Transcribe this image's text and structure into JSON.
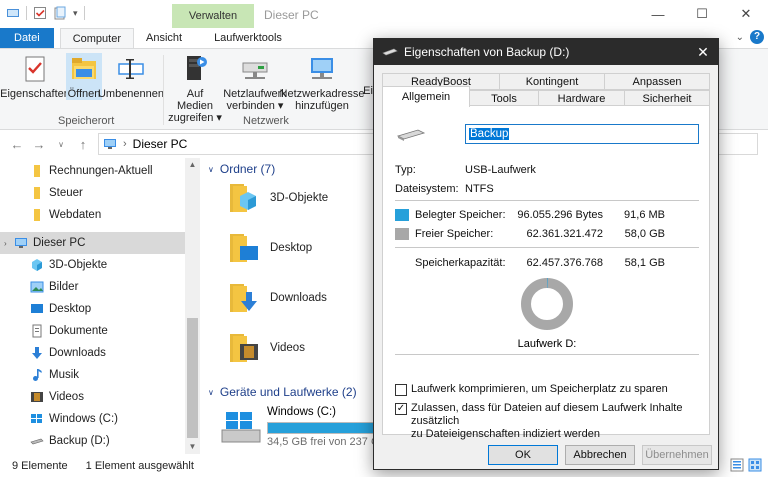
{
  "titlebar": {
    "context_tab": "Verwalten",
    "title": "Dieser PC",
    "minimize": "—",
    "maximize": "☐",
    "close": "✕"
  },
  "ribbon_tabs": {
    "file": "Datei",
    "computer": "Computer",
    "view": "Ansicht",
    "drive_tools": "Laufwerktools"
  },
  "ribbon": {
    "properties": "Eigenschaften",
    "open": "Öffnen",
    "rename": "Umbenennen",
    "access_media_1": "Auf Medien",
    "access_media_2": "zugreifen ▾",
    "map_drive_1": "Netzlaufwerk",
    "map_drive_2": "verbinden ▾",
    "add_network_1": "Netzwerkadresse",
    "add_network_2": "hinzufügen",
    "truncated": "Ei",
    "group_location": "Speicherort",
    "group_network": "Netzwerk"
  },
  "address": {
    "path": "Dieser PC",
    "sep": "›"
  },
  "sidebar": {
    "items": [
      {
        "label": "Rechnungen-Aktuell"
      },
      {
        "label": "Steuer"
      },
      {
        "label": "Webdaten"
      },
      {
        "label": "Dieser PC"
      },
      {
        "label": "3D-Objekte"
      },
      {
        "label": "Bilder"
      },
      {
        "label": "Desktop"
      },
      {
        "label": "Dokumente"
      },
      {
        "label": "Downloads"
      },
      {
        "label": "Musik"
      },
      {
        "label": "Videos"
      },
      {
        "label": "Windows  (C:)"
      },
      {
        "label": "Backup (D:)"
      }
    ]
  },
  "content": {
    "folders_header": "Ordner (7)",
    "folders": [
      {
        "label": "3D-Objekte"
      },
      {
        "label": "Desktop"
      },
      {
        "label": "Downloads"
      },
      {
        "label": "Videos"
      }
    ],
    "drives_header": "Geräte und Laufwerke (2)",
    "drive_c_label": "Windows  (C:)",
    "drive_c_free": "34,5 GB frei von 237 G",
    "drive_c_used_fraction": 0.855
  },
  "status": {
    "count": "9 Elemente",
    "selected": "1 Element ausgewählt"
  },
  "dialog": {
    "title": "Eigenschaften von Backup (D:)",
    "close": "✕",
    "tabs_row1": [
      "ReadyBoost",
      "Kontingent",
      "Anpassen"
    ],
    "tabs_row2": [
      "Allgemein",
      "Tools",
      "Hardware",
      "Sicherheit"
    ],
    "name_value": "Backup",
    "type_label": "Typ:",
    "type_value": "USB-Laufwerk",
    "fs_label": "Dateisystem:",
    "fs_value": "NTFS",
    "used_label": "Belegter Speicher:",
    "used_bytes": "96.055.296 Bytes",
    "used_size": "91,6 MB",
    "free_label": "Freier Speicher:",
    "free_bytes": "62.361.321.472",
    "free_size": "58,0 GB",
    "cap_label": "Speicherkapazität:",
    "cap_bytes": "62.457.376.768",
    "cap_size": "58,1 GB",
    "drive_caption": "Laufwerk D:",
    "compress_label": "Laufwerk komprimieren, um Speicherplatz zu sparen",
    "compress_checked": false,
    "index_label_1": "Zulassen, dass für Dateien auf diesem Laufwerk Inhalte zusätzlich",
    "index_label_2": "zu Dateieigenschaften indiziert werden",
    "index_checked": true,
    "ok": "OK",
    "cancel": "Abbrechen",
    "apply": "Übernehmen",
    "used_fraction": 0.0015,
    "colors": {
      "used": "#26a0da",
      "free": "#a8a8a8"
    }
  },
  "colors": {
    "accent": "#1979ca",
    "context_tab": "#c8e6b5",
    "dialog_titlebar": "#2b2b2b",
    "folder": "#f4c542",
    "drive_bar": "#26a0da"
  }
}
